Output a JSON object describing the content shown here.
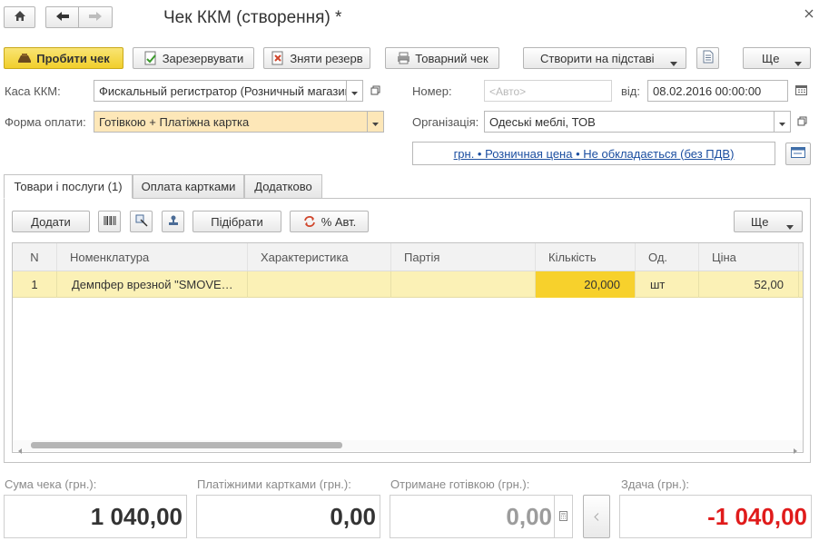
{
  "window": {
    "title": "Чек ККМ (створення) *"
  },
  "toolbar": {
    "post_check": "Пробити чек",
    "reserve": "Зарезервувати",
    "unreserve": "Зняти резерв",
    "goods_check": "Товарний чек",
    "create_based": "Створити на підставі",
    "more": "Ще"
  },
  "form": {
    "cash_register_label": "Каса ККМ:",
    "cash_register_value": "Фискальный регистратор (Розничный магазин",
    "payment_form_label": "Форма оплати:",
    "payment_form_value": "Готівкою + Платіжна картка",
    "number_label": "Номер:",
    "number_placeholder": "<Авто>",
    "date_label": "від:",
    "date_value": "08.02.2016 00:00:00",
    "organization_label": "Організація:",
    "organization_value": "Одеські меблі, ТОВ",
    "price_link": "грн. • Розничная цена • Не обкладається (без ПДВ)"
  },
  "tabs": [
    {
      "label": "Товари і послуги (1)"
    },
    {
      "label": "Оплата картками"
    },
    {
      "label": "Додатково"
    }
  ],
  "table_toolbar": {
    "add": "Додати",
    "pick": "Підібрати",
    "auto_discount": "% Авт.",
    "more": "Ще"
  },
  "table": {
    "columns": [
      "N",
      "Номенклатура",
      "Характеристика",
      "Партія",
      "Кількість",
      "Од.",
      "Ціна"
    ],
    "rows": [
      {
        "n": "1",
        "item": "Демпфер врезной \"SMOVE…",
        "characteristic": "",
        "batch": "",
        "qty": "20,000",
        "unit": "шт",
        "price": "52,00"
      }
    ]
  },
  "totals": {
    "check_sum_label": "Сума чека (грн.):",
    "check_sum": "1 040,00",
    "cards_label": "Платіжними картками (грн.):",
    "cards": "0,00",
    "cash_label": "Отримане готівкою (грн.):",
    "cash": "0,00",
    "change_label": "Здача (грн.):",
    "change": "-1 040,00"
  },
  "colors": {
    "primary_button": "#f4d543",
    "selected_row": "#fbf1b6",
    "selected_cell": "#f7d12c",
    "highlight_field": "#fde7b8",
    "link": "#1b4ea0",
    "negative": "#e01b1b"
  }
}
